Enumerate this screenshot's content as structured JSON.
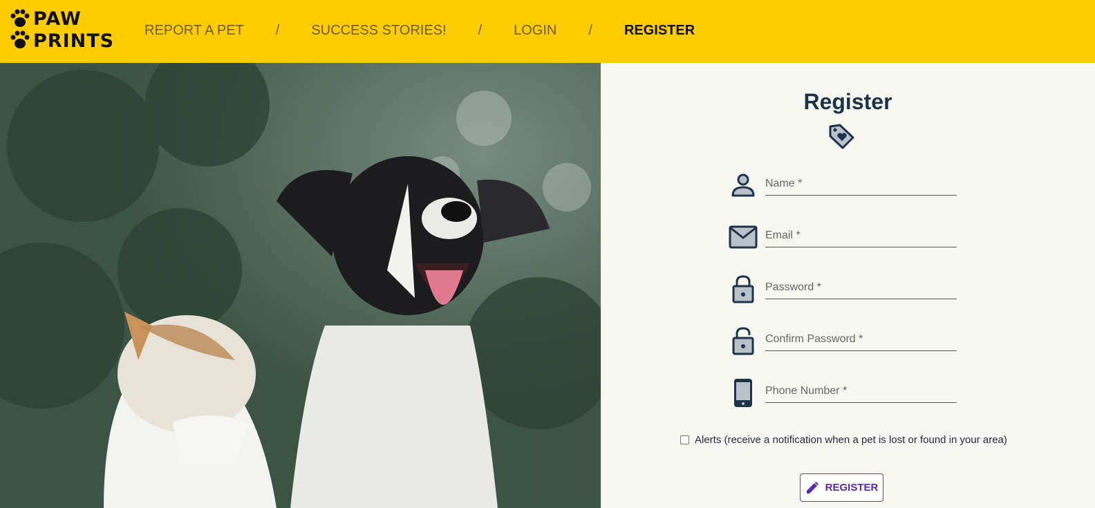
{
  "logo": {
    "line1": "PAW",
    "line2": "PRINTS"
  },
  "nav": {
    "items": [
      {
        "label": "REPORT A PET"
      },
      {
        "label": "SUCCESS STORIES!"
      },
      {
        "label": "LOGIN"
      },
      {
        "label": "REGISTER",
        "active": true
      }
    ],
    "separator": "/"
  },
  "form": {
    "title": "Register",
    "fields": [
      {
        "label": "Name *",
        "icon": "person-icon"
      },
      {
        "label": "Email *",
        "icon": "mail-icon"
      },
      {
        "label": "Password *",
        "icon": "lock-icon"
      },
      {
        "label": "Confirm Password *",
        "icon": "unlock-icon"
      },
      {
        "label": "Phone Number *",
        "icon": "phone-icon"
      }
    ],
    "alerts_label": "Alerts (receive a notification when a pet is lost or found in your area)",
    "submit_label": "REGISTER"
  },
  "colors": {
    "topbar": "#fecc00",
    "panel": "#f8f8f2",
    "heading": "#1e3348",
    "button": "#5a27ad"
  }
}
